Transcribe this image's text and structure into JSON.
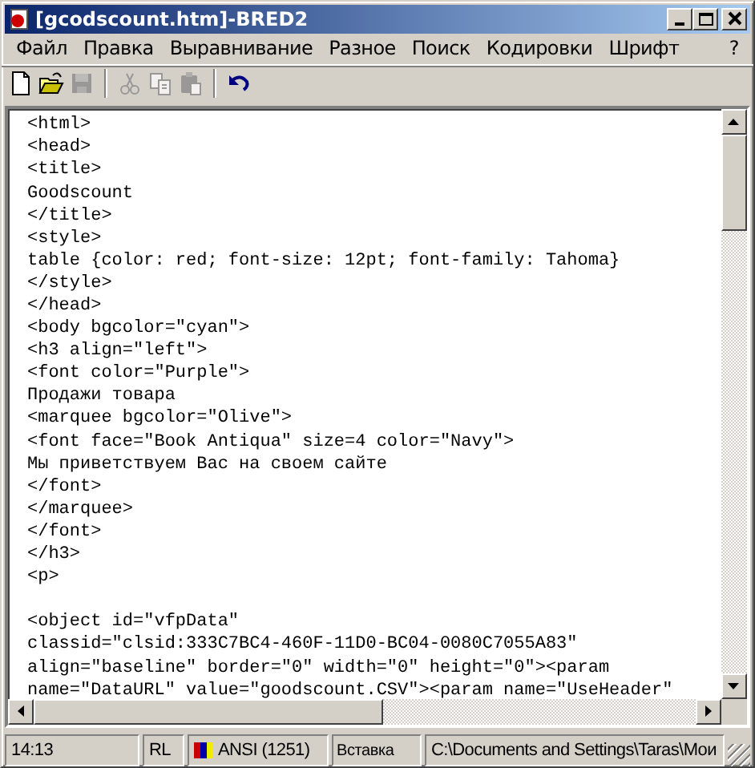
{
  "window": {
    "title": "[gcodscount.htm]-BRED2"
  },
  "menu": [
    "Файл",
    "Правка",
    "Выравнивание",
    "Разное",
    "Поиск",
    "Кодировки",
    "Шрифт",
    "?"
  ],
  "toolbar": [
    {
      "kind": "new",
      "disabled": false
    },
    {
      "kind": "open",
      "disabled": false
    },
    {
      "kind": "save",
      "disabled": true
    },
    {
      "kind": "sep"
    },
    {
      "kind": "cut",
      "disabled": true
    },
    {
      "kind": "copy",
      "disabled": true
    },
    {
      "kind": "paste",
      "disabled": true
    },
    {
      "kind": "sep"
    },
    {
      "kind": "undo",
      "disabled": false
    }
  ],
  "editor": {
    "lines": [
      {
        "text": "<html>"
      },
      {
        "text": "<head>"
      },
      {
        "text": "<title>"
      },
      {
        "text": "Goodscount"
      },
      {
        "text": "</title>"
      },
      {
        "text": "<style>"
      },
      {
        "text": "table {color: red; font-size: 12pt; font-family: Tahoma}"
      },
      {
        "text": "</style>"
      },
      {
        "text": "</head>"
      },
      {
        "text": "<body bgcolor=\"cyan\">"
      },
      {
        "text": "<h3 align=\"left\">"
      },
      {
        "text": "<font color=\"Purple\">"
      },
      {
        "text": "Продажи товара"
      },
      {
        "text": "<marquee bgcolor=\"Olive\">"
      },
      {
        "text": "<font face=\"Book Antiqua\" size=4 color=\"Navy\">"
      },
      {
        "text": "Мы приветствуем Вас на своем сайте"
      },
      {
        "text": "</font>"
      },
      {
        "text": "</marquee>"
      },
      {
        "text": "</font>"
      },
      {
        "text": "</h3>"
      },
      {
        "text": "<p>"
      },
      {
        "text": "<object id=\"vfpData\"",
        "blank_before": true
      },
      {
        "text": "classid=\"clsid:333C7BC4-460F-11D0-BC04-0080C7055A83\""
      },
      {
        "text": "align=\"baseline\" border=\"0\" width=\"0\" height=\"0\"><param"
      },
      {
        "text": "name=\"DataURL\" value=\"goodscount.CSV\"><param name=\"UseHeader\""
      }
    ]
  },
  "status_bar": [
    {
      "kind": "position",
      "text": "14:13"
    },
    {
      "kind": "mode",
      "text": "RL"
    },
    {
      "kind": "encoding",
      "text": "ANSI (1251)"
    },
    {
      "kind": "insert",
      "text": "Вставка"
    },
    {
      "kind": "path",
      "text": "C:\\Documents and Settings\\Taras\\Мои"
    }
  ]
}
